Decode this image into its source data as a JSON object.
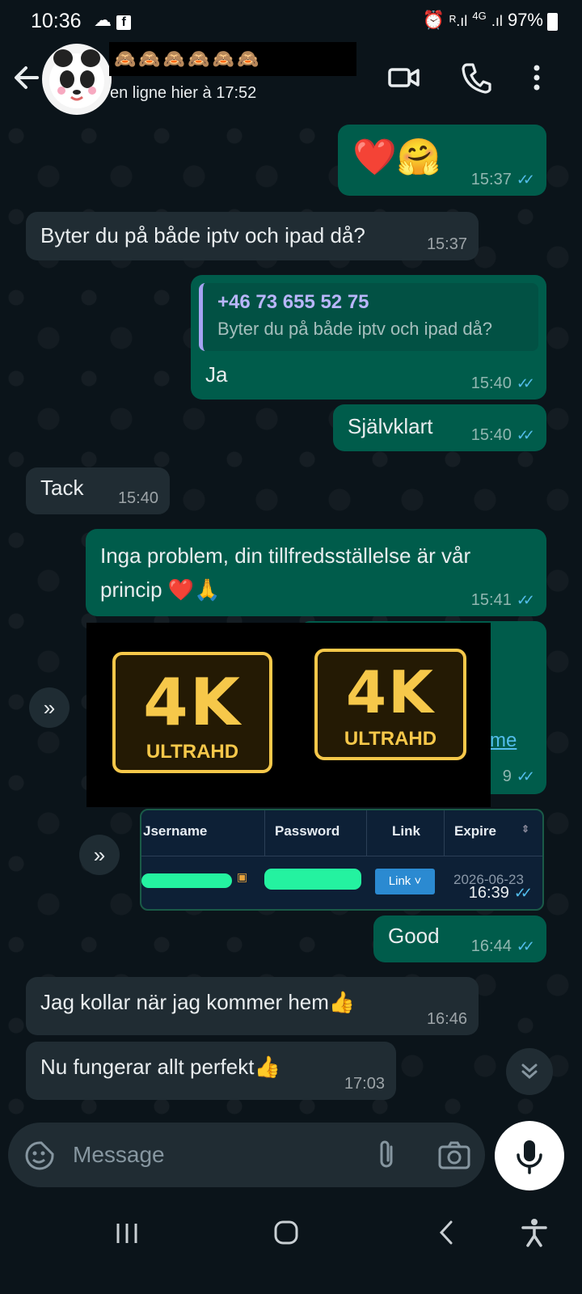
{
  "status_bar": {
    "time": "10:36",
    "battery": "97%",
    "network": "4G"
  },
  "header": {
    "contact_name": "🙈🙈🙈🙈🙈🙈",
    "contact_status": "en ligne hier à 17:52"
  },
  "messages": [
    {
      "dir": "out",
      "text": "❤️🤗",
      "time": "15:37"
    },
    {
      "dir": "in",
      "text": "Byter du på både iptv och ipad då?",
      "time": "15:37"
    },
    {
      "dir": "out",
      "reply_name": "+46 73 655 52 75",
      "reply_text": "Byter du på både iptv och ipad då?",
      "text": "Ja",
      "time": "15:40"
    },
    {
      "dir": "out",
      "text": "Självklart",
      "time": "15:40"
    },
    {
      "dir": "in",
      "text": "Tack",
      "time": "15:40"
    },
    {
      "dir": "out",
      "text_line1": "Inga problem, din tillfredsställelse är vår",
      "text_line2": "princip ❤️🙏",
      "time": "15:41"
    },
    {
      "dir": "out",
      "image_labels": [
        "4K",
        "ULTRAHD",
        "4K",
        "ULTRAHD"
      ],
      "link_fragment": "me",
      "time_fragment": "9"
    },
    {
      "dir": "out",
      "table_headers": [
        "Jsername",
        "Password",
        "Link",
        "Expire"
      ],
      "link_button": "Link",
      "expire_value": "2026-06-23",
      "time": "16:39"
    },
    {
      "dir": "out",
      "text": "Good",
      "time": "16:44"
    },
    {
      "dir": "in",
      "text": "Jag kollar när jag kommer hem👍",
      "time": "16:46"
    },
    {
      "dir": "in",
      "text": "Nu fungerar allt perfekt👍",
      "time": "17:03"
    }
  ],
  "input": {
    "placeholder": "Message"
  },
  "colors": {
    "bg": "#0b141a",
    "incoming": "#202c33",
    "outgoing": "#005c4b",
    "ticks": "#53bdeb",
    "badge": "#f6c84a"
  }
}
